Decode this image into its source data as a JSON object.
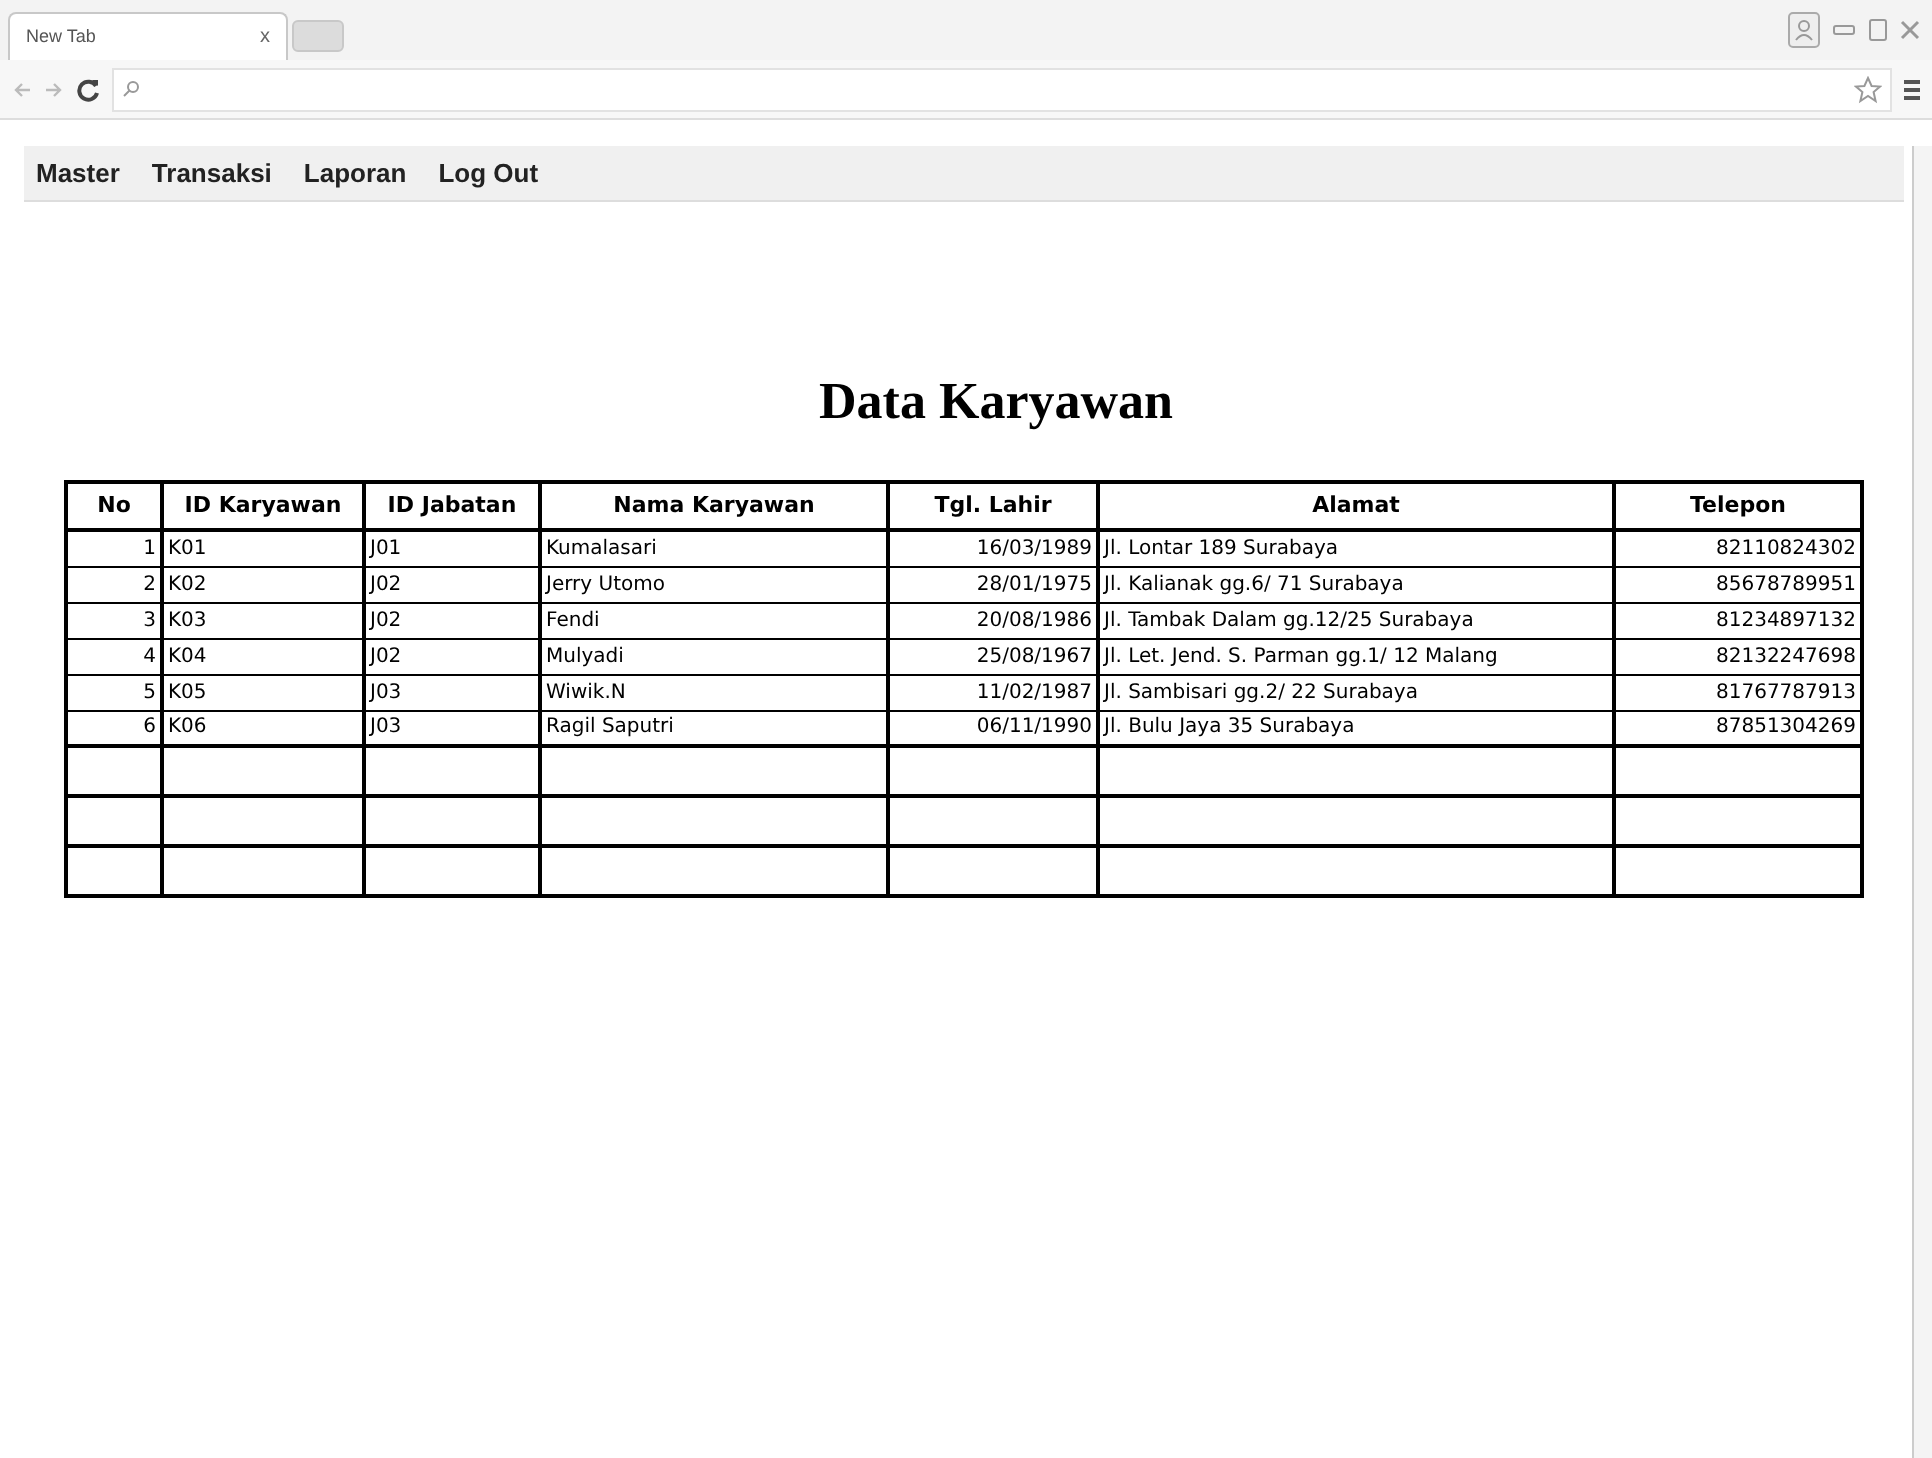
{
  "browser": {
    "tab_title": "New Tab",
    "tab_close": "x"
  },
  "menu": [
    "Master",
    "Transaksi",
    "Laporan",
    "Log Out"
  ],
  "title": "Data Karyawan",
  "table": {
    "columns": [
      "No",
      "ID Karyawan",
      "ID Jabatan",
      "Nama Karyawan",
      "Tgl. Lahir",
      "Alamat",
      "Telepon"
    ],
    "rows": [
      {
        "kind": "data",
        "cells": [
          "1",
          "K01",
          "J01",
          "Kumalasari",
          "16/03/1989",
          "Jl. Lontar 189 Surabaya",
          "82110824302"
        ]
      },
      {
        "kind": "data",
        "cells": [
          "2",
          "K02",
          "J02",
          "Jerry Utomo",
          "28/01/1975",
          "Jl. Kalianak gg.6/ 71 Surabaya",
          "85678789951"
        ]
      },
      {
        "kind": "data",
        "cells": [
          "3",
          "K03",
          "J02",
          "Fendi",
          "20/08/1986",
          "Jl. Tambak Dalam gg.12/25 Surabaya",
          "81234897132"
        ]
      },
      {
        "kind": "data",
        "cells": [
          "4",
          "K04",
          "J02",
          "Mulyadi",
          "25/08/1967",
          "Jl. Let. Jend. S. Parman gg.1/ 12 Malang",
          "82132247698"
        ]
      },
      {
        "kind": "data",
        "cells": [
          "5",
          "K05",
          "J03",
          "Wiwik.N",
          "11/02/1987",
          "Jl. Sambisari gg.2/ 22 Surabaya",
          "81767787913"
        ]
      },
      {
        "kind": "data",
        "cells": [
          "6",
          "K06",
          "J03",
          "Ragil Saputri",
          "06/11/1990",
          "Jl. Bulu Jaya 35 Surabaya",
          "87851304269"
        ]
      },
      {
        "kind": "blank"
      },
      {
        "kind": "blank"
      },
      {
        "kind": "blank"
      }
    ]
  }
}
